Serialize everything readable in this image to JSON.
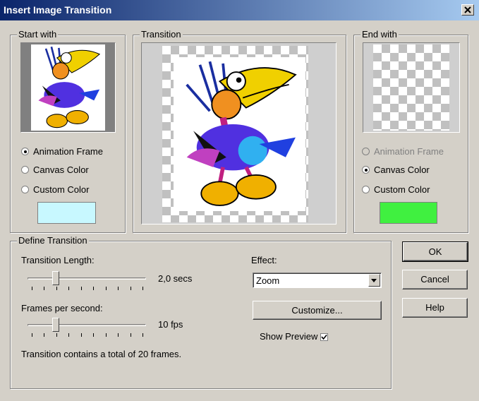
{
  "window": {
    "title": "Insert Image Transition",
    "close_glyph": "×"
  },
  "start_with": {
    "title": "Start with",
    "options": [
      "Animation Frame",
      "Canvas Color",
      "Custom Color"
    ],
    "selected": "Animation Frame",
    "custom_color": "#c8f8ff"
  },
  "transition": {
    "title": "Transition"
  },
  "end_with": {
    "title": "End with",
    "options": [
      "Animation Frame",
      "Canvas Color",
      "Custom Color"
    ],
    "selected": "Canvas Color",
    "custom_color": "#40f040"
  },
  "define": {
    "title": "Define Transition",
    "length_label": "Transition Length:",
    "length_value": "2,0 secs",
    "length_slider_fraction": 0.22,
    "fps_label": "Frames per second:",
    "fps_value": "10 fps",
    "fps_slider_fraction": 0.22,
    "summary": "Transition contains a total of 20 frames.",
    "effect_label": "Effect:",
    "effect_value": "Zoom",
    "customize_label": "Customize...",
    "show_preview_label": "Show Preview",
    "show_preview_checked": true
  },
  "buttons": {
    "ok": "OK",
    "cancel": "Cancel",
    "help": "Help"
  }
}
